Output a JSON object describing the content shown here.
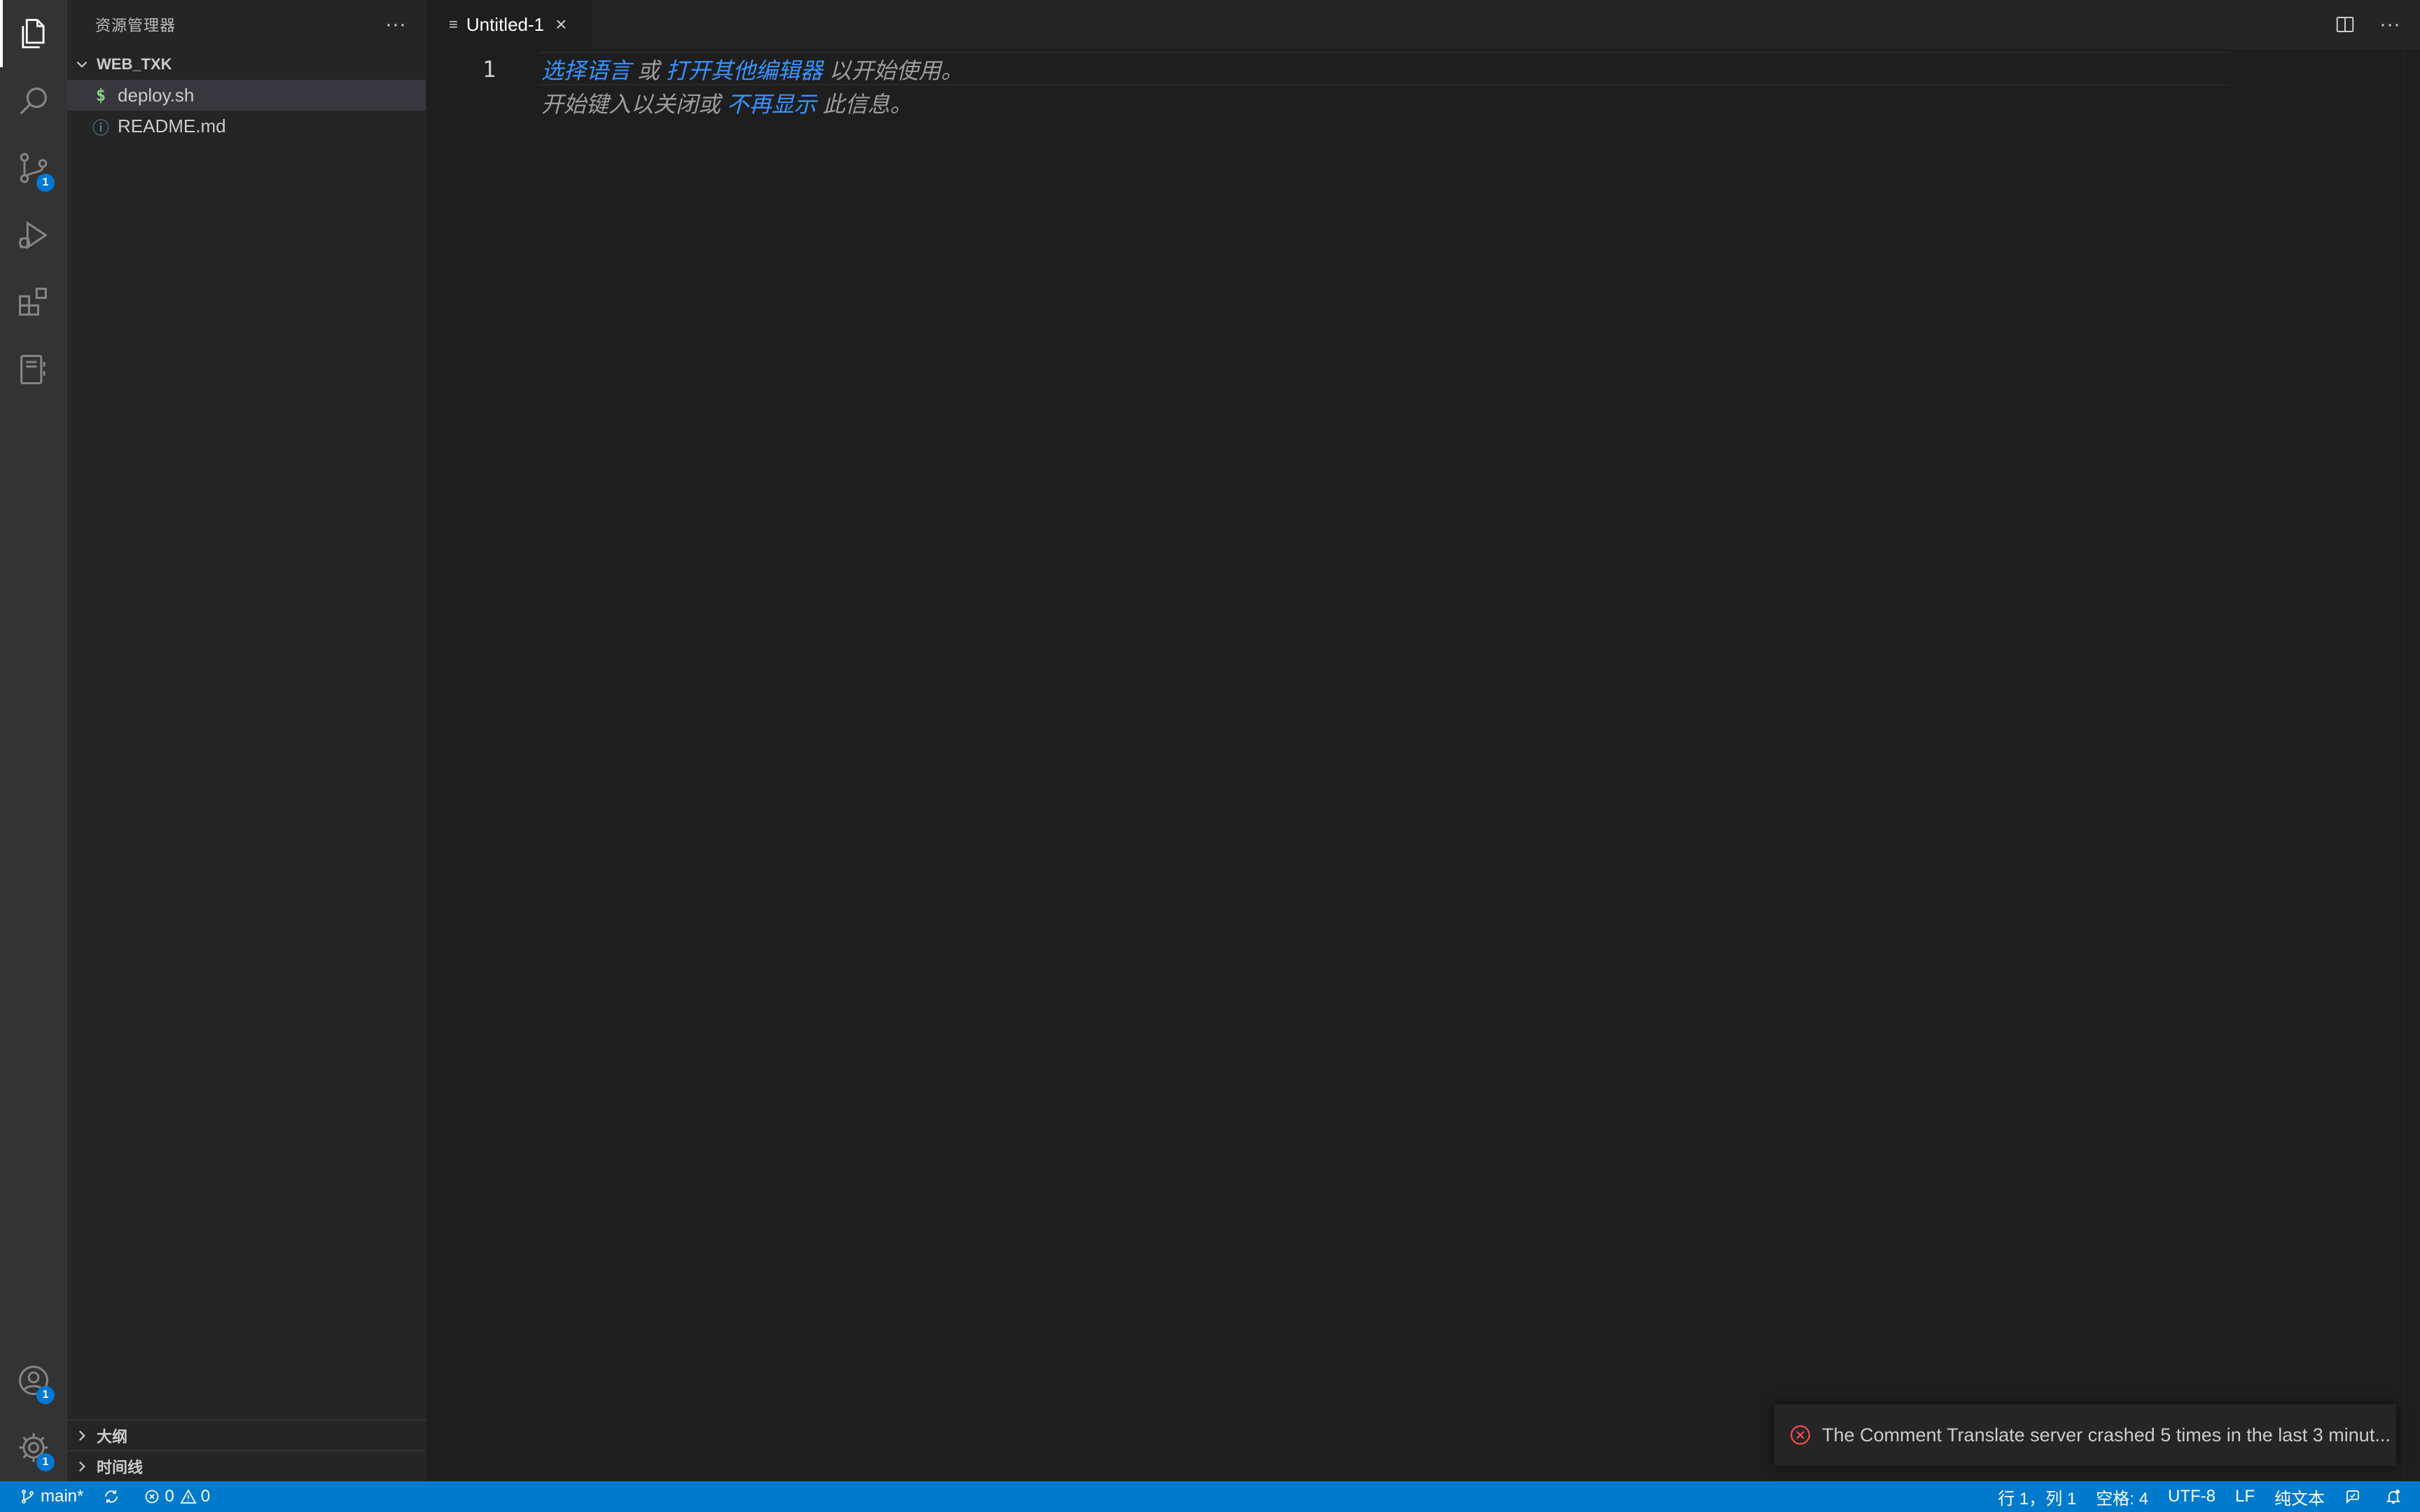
{
  "activity_bar": {
    "items": [
      {
        "name": "explorer",
        "icon": "files-icon",
        "active": true
      },
      {
        "name": "search",
        "icon": "search-icon"
      },
      {
        "name": "source-control",
        "icon": "source-control-icon",
        "badge": "1"
      },
      {
        "name": "run-debug",
        "icon": "run-debug-icon"
      },
      {
        "name": "extensions",
        "icon": "extensions-icon"
      },
      {
        "name": "notebook",
        "icon": "notebook-icon"
      }
    ],
    "bottom": [
      {
        "name": "accounts",
        "icon": "account-icon",
        "badge": "1"
      },
      {
        "name": "manage",
        "icon": "gear-icon",
        "badge": "1"
      }
    ]
  },
  "sidebar": {
    "title": "资源管理器",
    "folder": "WEB_TXK",
    "files": [
      {
        "label": "deploy.sh",
        "icon": "$",
        "selected": true
      },
      {
        "label": "README.md",
        "icon": "ⓘ",
        "selected": false
      }
    ],
    "outline_label": "大纲",
    "timeline_label": "时间线"
  },
  "editor": {
    "tab_label": "Untitled-1",
    "line_number": "1",
    "hint_line1": {
      "link1": "选择语言",
      "or": " 或 ",
      "link2": "打开其他编辑器",
      "suffix": " 以开始使用。"
    },
    "hint_line2": {
      "prefix": "开始键入以关闭或 ",
      "link": "不再显示",
      "suffix": " 此信息。"
    }
  },
  "notification": {
    "message": "The Comment Translate server crashed 5 times in the last 3 minut..."
  },
  "statusbar": {
    "branch": "main*",
    "errors": "0",
    "warnings": "0",
    "position": "行 1，列 1",
    "spaces": "空格: 4",
    "encoding": "UTF-8",
    "eol": "LF",
    "language": "纯文本",
    "accent_color": "#007acc"
  }
}
